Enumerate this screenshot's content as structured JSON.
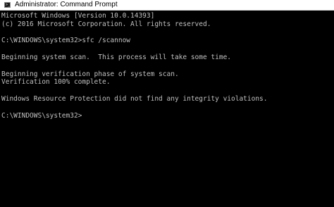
{
  "window": {
    "title": "Administrator: Command Prompt",
    "icon": "command-prompt-icon"
  },
  "console": {
    "lines": [
      "Microsoft Windows [Version 10.0.14393]",
      "(c) 2016 Microsoft Corporation. All rights reserved.",
      "",
      "C:\\WINDOWS\\system32>sfc /scannow",
      "",
      "Beginning system scan.  This process will take some time.",
      "",
      "Beginning verification phase of system scan.",
      "Verification 100% complete.",
      "",
      "Windows Resource Protection did not find any integrity violations.",
      "",
      "C:\\WINDOWS\\system32>"
    ],
    "text_color": "#c0c0c0",
    "background_color": "#000000"
  }
}
